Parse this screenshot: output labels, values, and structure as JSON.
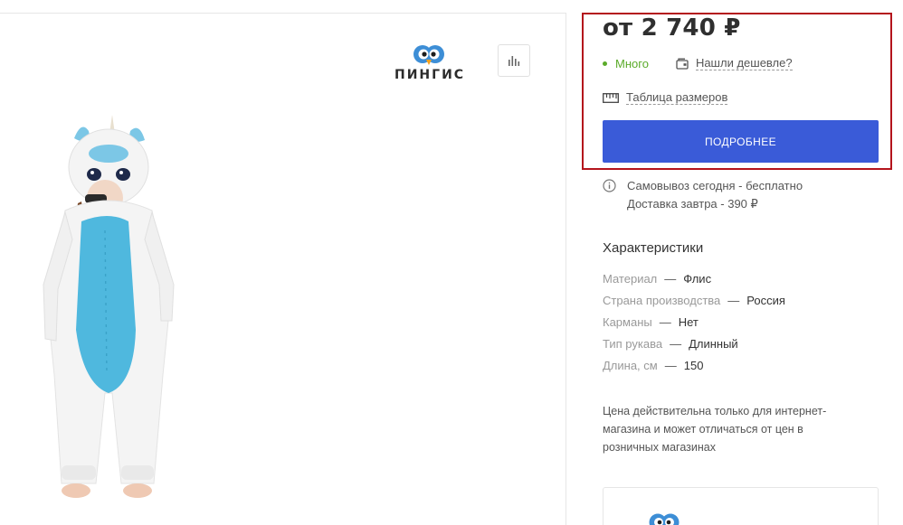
{
  "brand": {
    "name": "ПИНГИС"
  },
  "product": {
    "image_alt": "unicorn-kigurumi-photo"
  },
  "offer": {
    "price": "от 2 740 ₽",
    "stock_status": "Много",
    "cheaper_link": "Нашли дешевле?",
    "size_table_link": "Таблица размеров",
    "details_button": "ПОДРОБНЕЕ",
    "pickup": "Самовывоз сегодня - бесплатно",
    "delivery": "Доставка завтра - 390 ₽"
  },
  "characteristics": {
    "title": "Характеристики",
    "items": [
      {
        "name": "Материал",
        "value": "Флис"
      },
      {
        "name": "Страна производства",
        "value": "Россия"
      },
      {
        "name": "Карманы",
        "value": "Нет"
      },
      {
        "name": "Тип рукава",
        "value": "Длинный"
      },
      {
        "name": "Длина, см",
        "value": "150"
      }
    ]
  },
  "note": {
    "line1": "Цена действительна только для интернет-",
    "line2": "магазина и может отличаться от цен в",
    "line3": "розничных магазинах"
  },
  "colors": {
    "accent_button": "#3a5bd8",
    "stock_green": "#5bab2a",
    "highlight_border": "#b4141c",
    "brand_blue": "#3d8ed6"
  }
}
